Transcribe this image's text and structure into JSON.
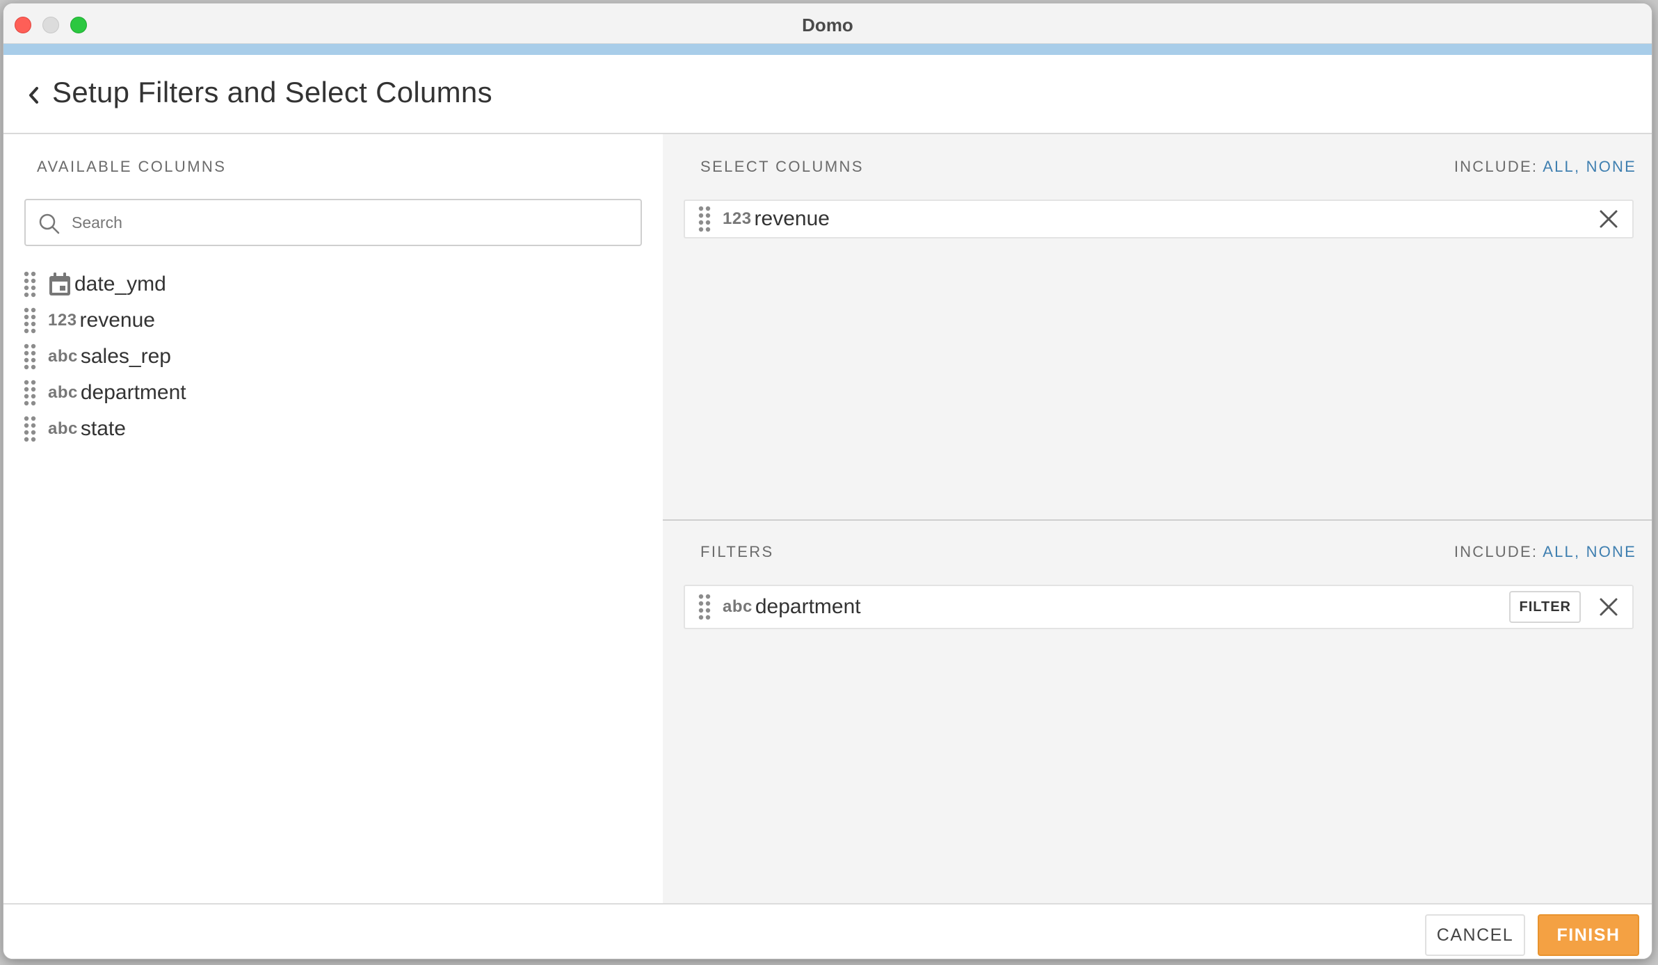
{
  "window": {
    "title": "Domo"
  },
  "header": {
    "title": "Setup Filters and Select Columns"
  },
  "available_columns": {
    "label": "AVAILABLE COLUMNS",
    "search_placeholder": "Search",
    "items": [
      {
        "name": "date_ymd",
        "type": "date",
        "type_label": ""
      },
      {
        "name": "revenue",
        "type": "number",
        "type_label": "123"
      },
      {
        "name": "sales_rep",
        "type": "text",
        "type_label": "abc"
      },
      {
        "name": "department",
        "type": "text",
        "type_label": "abc"
      },
      {
        "name": "state",
        "type": "text",
        "type_label": "abc"
      }
    ]
  },
  "select_columns": {
    "label": "SELECT COLUMNS",
    "include_label": "INCLUDE:",
    "include_all": "ALL",
    "separator": ",",
    "include_none": "NONE",
    "items": [
      {
        "name": "revenue",
        "type": "number",
        "type_label": "123"
      }
    ]
  },
  "filters": {
    "label": "FILTERS",
    "include_label": "INCLUDE:",
    "include_all": "ALL",
    "separator": ",",
    "include_none": "NONE",
    "items": [
      {
        "name": "department",
        "type": "text",
        "type_label": "abc",
        "button_label": "FILTER"
      }
    ]
  },
  "footer": {
    "cancel_label": "CANCEL",
    "finish_label": "FINISH"
  },
  "colors": {
    "accent_bar": "#a8cde9",
    "link": "#3f7fb0",
    "finish_button": "#f4a143",
    "right_pane_bg": "#f4f4f4"
  },
  "icons": {
    "back": "chevron-left-icon",
    "search": "search-icon",
    "drag": "drag-handle-icon",
    "date": "calendar-icon",
    "remove": "close-icon"
  }
}
